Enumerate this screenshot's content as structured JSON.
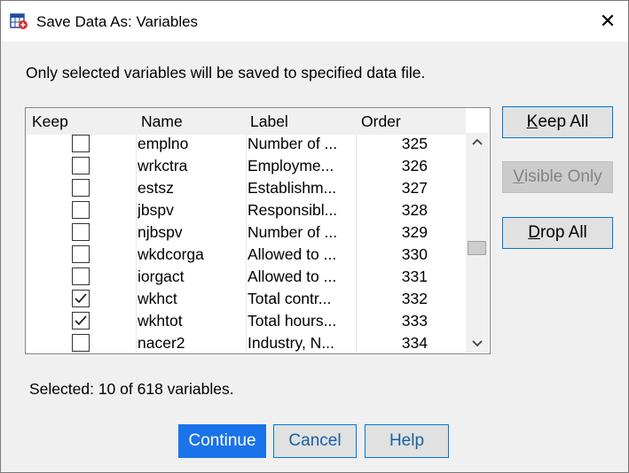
{
  "window": {
    "title": "Save Data As: Variables",
    "close_label": "✕"
  },
  "instruction": "Only selected variables will be saved to specified data file.",
  "table": {
    "headers": [
      "Keep",
      "Name",
      "Label",
      "Order"
    ],
    "rows": [
      {
        "keep": false,
        "name": "emplno",
        "label": "Number of ...",
        "order": "325"
      },
      {
        "keep": false,
        "name": "wrkctra",
        "label": "Employme...",
        "order": "326"
      },
      {
        "keep": false,
        "name": "estsz",
        "label": "Establishm...",
        "order": "327"
      },
      {
        "keep": false,
        "name": "jbspv",
        "label": "Responsibl...",
        "order": "328"
      },
      {
        "keep": false,
        "name": "njbspv",
        "label": "Number of ...",
        "order": "329"
      },
      {
        "keep": false,
        "name": "wkdcorga",
        "label": "Allowed to ...",
        "order": "330"
      },
      {
        "keep": false,
        "name": "iorgact",
        "label": "Allowed to ...",
        "order": "331"
      },
      {
        "keep": true,
        "name": "wkhct",
        "label": "Total contr...",
        "order": "332"
      },
      {
        "keep": true,
        "name": "wkhtot",
        "label": "Total hours...",
        "order": "333"
      },
      {
        "keep": false,
        "name": "nacer2",
        "label": "Industry, N...",
        "order": "334"
      }
    ]
  },
  "side_buttons": {
    "keep_all": {
      "mnemonic": "K",
      "rest": "eep All"
    },
    "visible_only": {
      "mnemonic": "V",
      "rest": "isible Only"
    },
    "drop_all": {
      "mnemonic": "D",
      "rest": "rop All"
    }
  },
  "status": "Selected: 10 of 618 variables.",
  "buttons": {
    "continue": "Continue",
    "cancel": "Cancel",
    "help": "Help"
  },
  "icons": {
    "app": "spss-data-icon",
    "close": "close-icon",
    "scroll_up": "chevron-up-icon",
    "scroll_down": "chevron-down-icon",
    "checkmark": "checkmark-icon"
  },
  "colors": {
    "accent": "#0078d7",
    "primary_button": "#1a73e8"
  }
}
